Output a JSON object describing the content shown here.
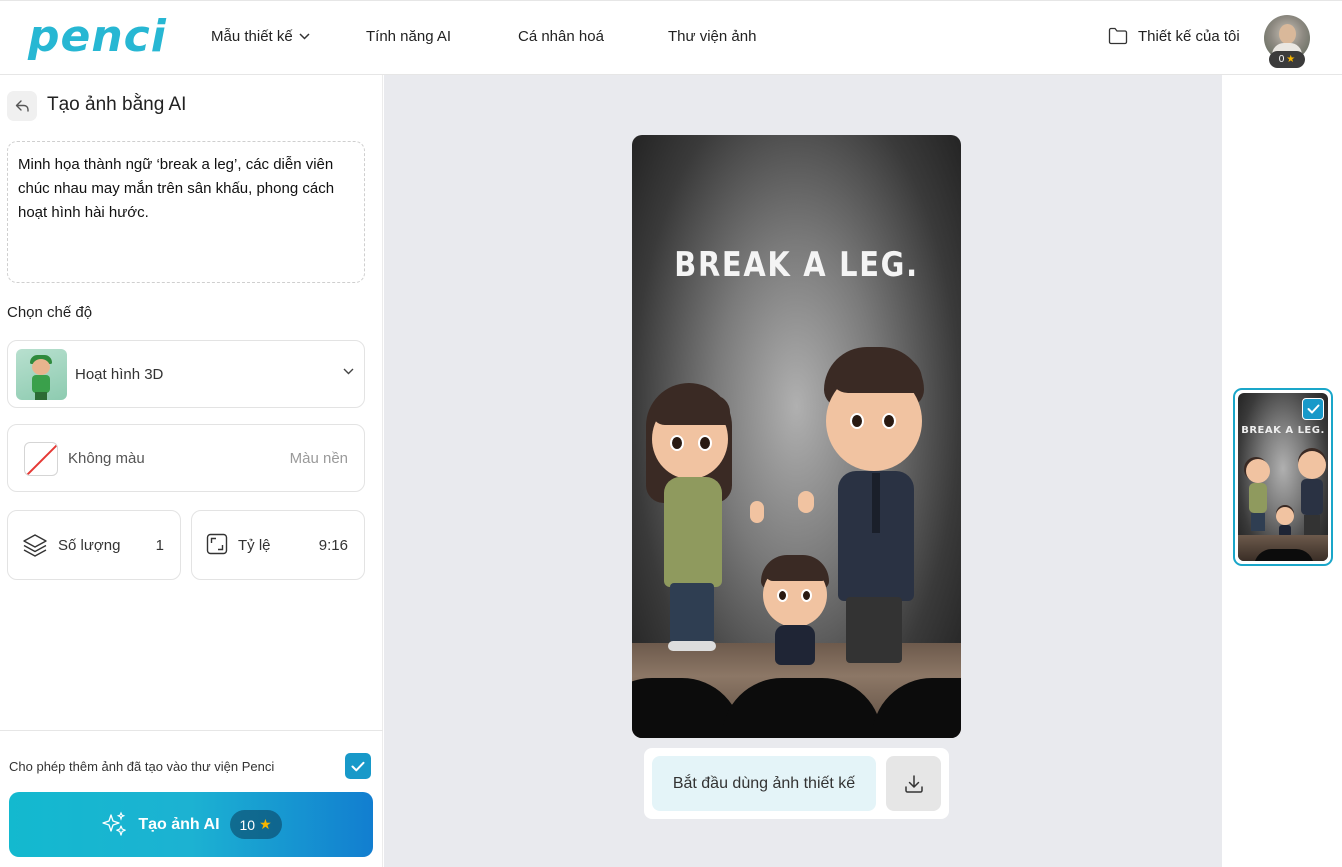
{
  "header": {
    "logo": "penci",
    "nav": [
      {
        "label": "Mẫu thiết kế",
        "has_dropdown": true
      },
      {
        "label": "Tính năng AI"
      },
      {
        "label": "Cá nhân hoá"
      },
      {
        "label": "Thư viện ảnh"
      }
    ],
    "my_designs": "Thiết kế của tôi",
    "credits": "0"
  },
  "left_panel": {
    "title": "Tạo ảnh bằng AI",
    "prompt": "Minh họa thành ngữ ‘break a leg’, các diễn viên chúc nhau may mắn trên sân khấu, phong cách hoạt hình hài hước.",
    "mode_label": "Chọn chế độ",
    "mode_value": "Hoạt hình 3D",
    "color_value": "Không màu",
    "color_label": "Màu nền",
    "quantity_label": "Số lượng",
    "quantity_value": "1",
    "ratio_label": "Tỷ lệ",
    "ratio_value": "9:16",
    "consent_text": "Cho phép thêm ảnh đã tạo vào thư viện Penci",
    "consent_checked": true,
    "generate_label": "Tạo ảnh AI",
    "generate_cost": "10"
  },
  "preview": {
    "headline": "BREAK A LEG.",
    "use_button": "Bắt đầu dùng ảnh thiết kế"
  },
  "thumbnails": [
    {
      "title": "BREAK A LEG.",
      "selected": true
    }
  ],
  "colors": {
    "brand": "#27b7d3",
    "accent": "#1899c9",
    "canvas_bg": "#e9eaee"
  }
}
